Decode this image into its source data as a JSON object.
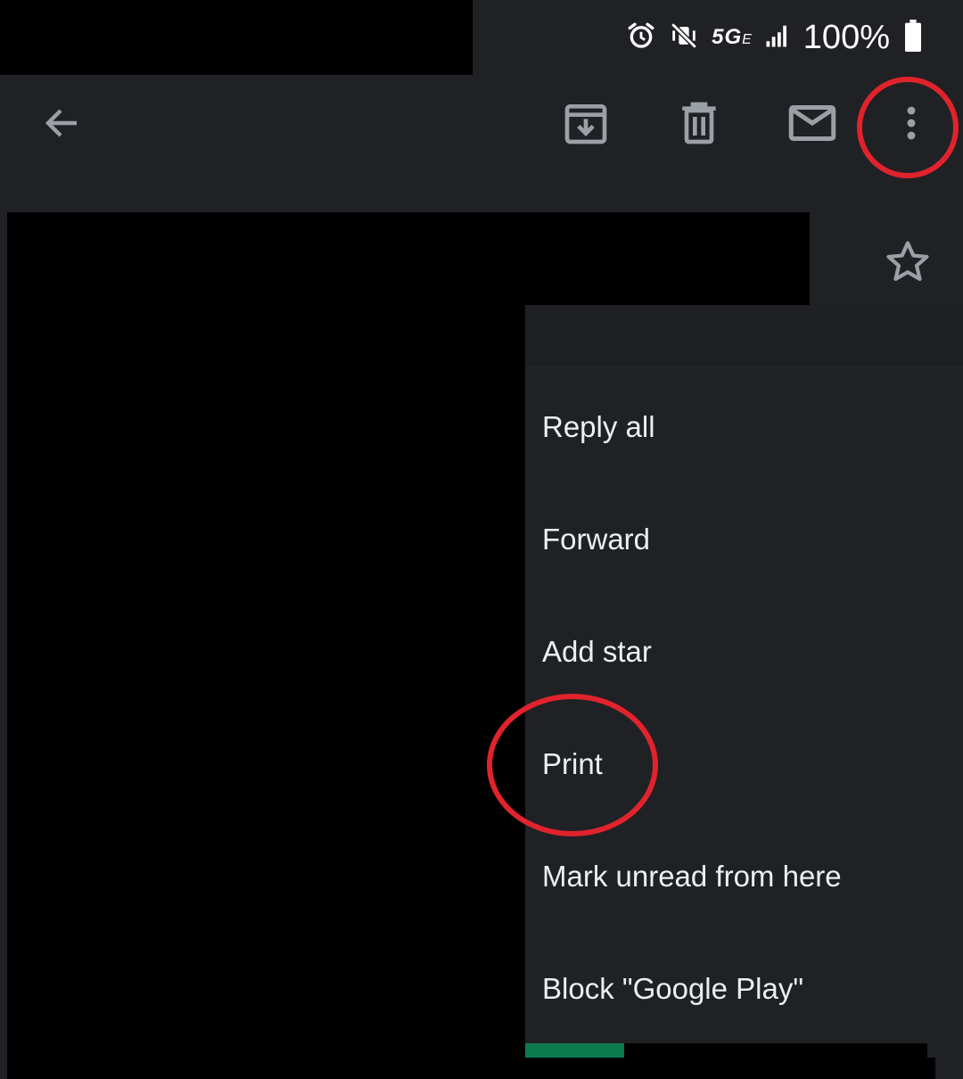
{
  "status_bar": {
    "network": "5G",
    "network_suffix": "E",
    "battery": "100%"
  },
  "toolbar": {
    "icons": [
      "back-arrow-icon",
      "archive-icon",
      "delete-icon",
      "mail-icon",
      "more-vert-icon"
    ]
  },
  "menu": {
    "items": [
      {
        "label": "Reply all"
      },
      {
        "label": "Forward"
      },
      {
        "label": "Add star"
      },
      {
        "label": "Print"
      },
      {
        "label": "Mark unread from here"
      },
      {
        "label": "Block \"Google Play\""
      }
    ]
  },
  "colors": {
    "background": "#202124",
    "icon": "#9aa0a6",
    "annotation": "#e0232c",
    "accent_bar": "#0b7a4e"
  }
}
